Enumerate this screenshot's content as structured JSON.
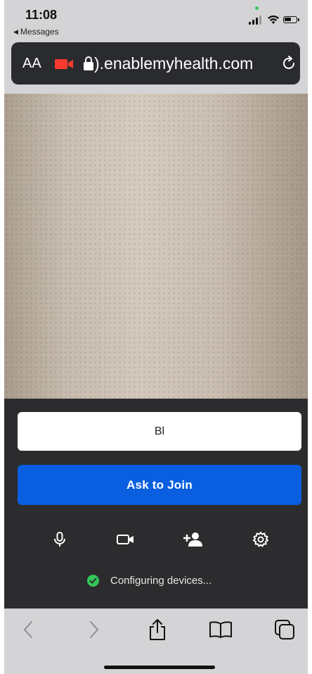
{
  "status_bar": {
    "time": "11:08",
    "back_app": "Messages",
    "back_icon": "back-triangle-icon"
  },
  "browser": {
    "text_size_label": "AA",
    "url": ").enablemyhealth.com",
    "camera_indicator_color": "#ff3b30"
  },
  "meeting": {
    "name_value": "Bl",
    "join_label": "Ask to Join",
    "join_color": "#0a5fe0",
    "controls": [
      "microphone-icon",
      "camera-icon",
      "add-person-icon",
      "settings-gear-icon"
    ],
    "status_text": "Configuring devices...",
    "status_color": "#34c759"
  },
  "toolbar": {
    "icons": [
      "back-chevron-icon",
      "forward-chevron-icon",
      "share-icon",
      "bookmarks-icon",
      "tabs-icon"
    ]
  }
}
